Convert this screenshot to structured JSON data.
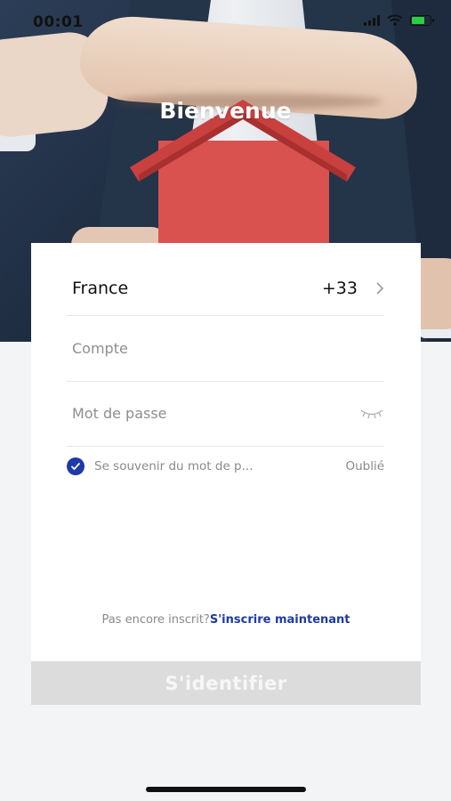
{
  "status_bar": {
    "time": "00:01",
    "icons": [
      "signal-icon",
      "wifi-icon",
      "battery-charging-icon"
    ]
  },
  "header": {
    "title": "Bienvenue",
    "background": "hand-over-red-house-photo"
  },
  "login_form": {
    "country": {
      "name": "France",
      "code": "+33",
      "icon": "chevron-right-icon"
    },
    "account": {
      "placeholder": "Compte",
      "value": ""
    },
    "password": {
      "placeholder": "Mot de passe",
      "value": "",
      "toggle_icon": "eye-closed-icon"
    },
    "remember": {
      "label": "Se souvenir du mot de p...",
      "checked": true
    },
    "forgot_label": "Oublié",
    "register_prompt": "Pas encore inscrit?",
    "register_link": "S'inscrire maintenant",
    "submit_label": "S'identifier"
  },
  "colors": {
    "accent": "#1e3aa8",
    "button_disabled": "#dcdcdc",
    "house": "#d9524f",
    "background": "#f3f4f6"
  }
}
